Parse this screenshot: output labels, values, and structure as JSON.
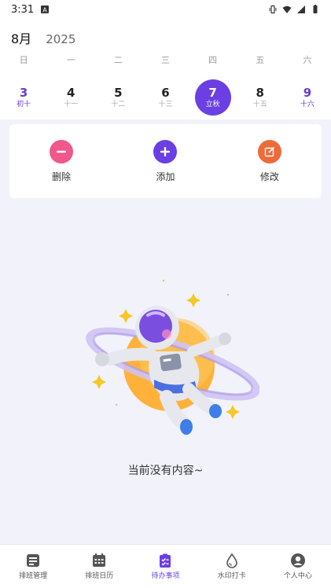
{
  "status_bar": {
    "time": "3:31"
  },
  "header": {
    "month": "8月",
    "year": "2025"
  },
  "weekdays": [
    "日",
    "一",
    "二",
    "三",
    "四",
    "五",
    "六"
  ],
  "days": [
    {
      "num": "3",
      "lunar": "初十"
    },
    {
      "num": "4",
      "lunar": "十一"
    },
    {
      "num": "5",
      "lunar": "十二"
    },
    {
      "num": "6",
      "lunar": "十三"
    },
    {
      "num": "7",
      "lunar": "立秋"
    },
    {
      "num": "8",
      "lunar": "十五"
    },
    {
      "num": "9",
      "lunar": "十六"
    }
  ],
  "actions": {
    "delete": "删除",
    "add": "添加",
    "edit": "修改"
  },
  "empty_text": "当前没有内容~",
  "nav": [
    {
      "label": "排班管理",
      "icon": "schedule-manage-icon"
    },
    {
      "label": "排班日历",
      "icon": "calendar-icon"
    },
    {
      "label": "待办事项",
      "icon": "todo-clipboard-icon"
    },
    {
      "label": "水印打卡",
      "icon": "water-drop-icon"
    },
    {
      "label": "个人中心",
      "icon": "person-icon"
    }
  ],
  "colors": {
    "accent": "#6b3fe3",
    "delete": "#f0578a",
    "add": "#6b3fe3",
    "edit": "#ee6a3a",
    "content_bg": "#f2f2fb"
  }
}
